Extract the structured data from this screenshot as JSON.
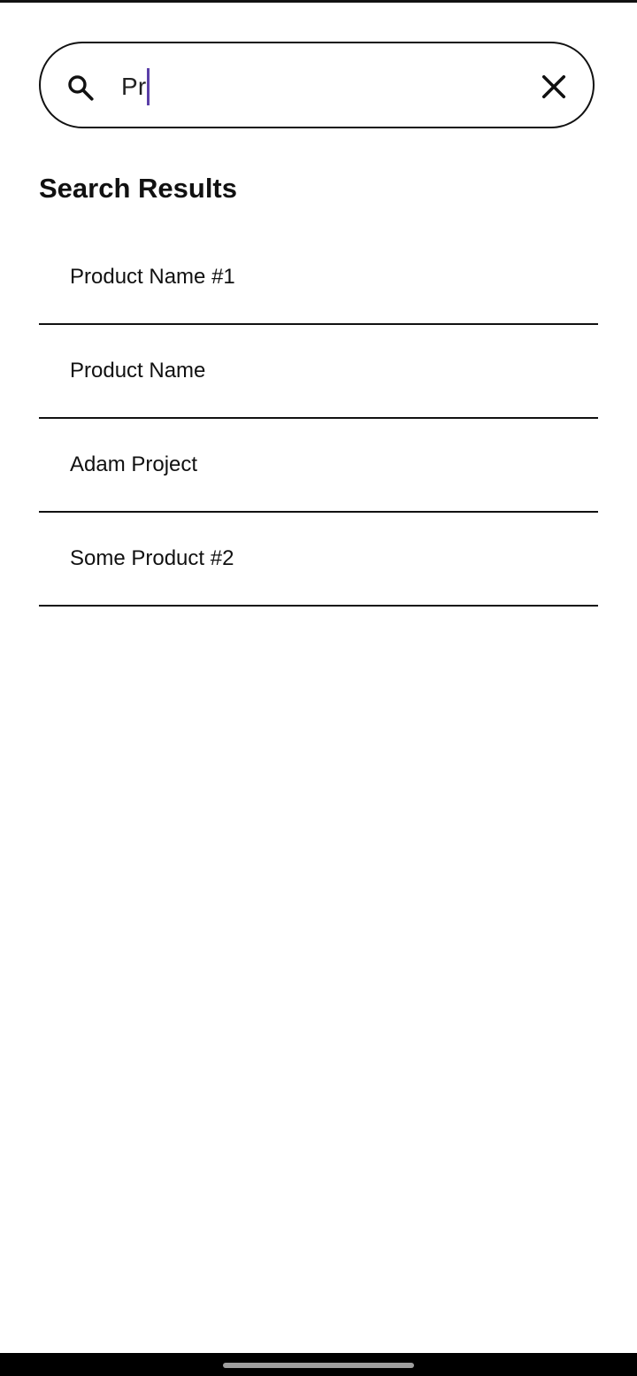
{
  "search": {
    "value": "Pr",
    "icon": "search-icon",
    "clear_icon": "close-icon",
    "caret_color": "#5b3fa8"
  },
  "results": {
    "title": "Search Results",
    "items": [
      {
        "label": "Product Name #1"
      },
      {
        "label": "Product Name"
      },
      {
        "label": "Adam Project"
      },
      {
        "label": "Some Product #2"
      }
    ]
  },
  "system": {
    "nav_bar_color": "#000000",
    "home_indicator_icon": "home-indicator"
  }
}
